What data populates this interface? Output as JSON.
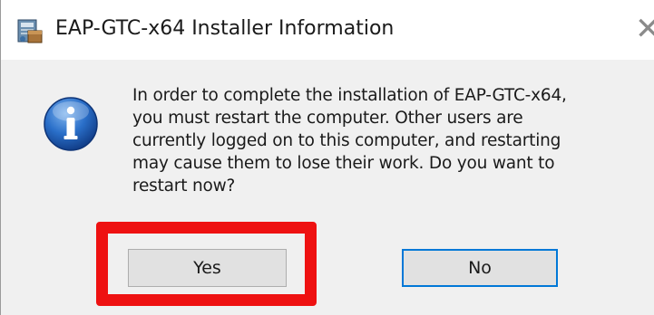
{
  "window": {
    "title": "EAP-GTC-x64 Installer Information",
    "app_icon": "installer-icon",
    "close_icon": "close-icon"
  },
  "message": {
    "icon": "info-icon",
    "text": "In order to complete the installation of EAP-GTC-x64,\nyou must restart the computer. Other users are\ncurrently logged on to this computer, and restarting\nmay cause them to lose their work. Do you want to\nrestart now?"
  },
  "buttons": {
    "yes_label": "Yes",
    "no_label": "No"
  },
  "annotation": {
    "highlight_color": "#ee1111"
  },
  "colors": {
    "dialog_bg": "#f0f0f0",
    "title_bg": "#ffffff",
    "focus_border": "#0078d7"
  }
}
